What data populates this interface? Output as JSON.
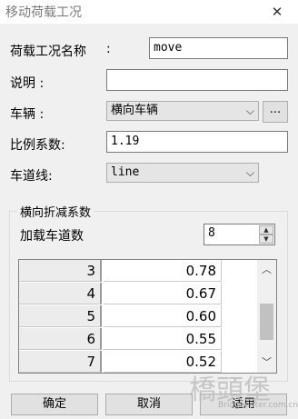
{
  "window": {
    "title": "移动荷载工况",
    "close_glyph": "✕"
  },
  "form": {
    "name_label": "荷载工况名称",
    "name_colon": ":",
    "name_value": "move",
    "desc_label": "说明 :",
    "desc_value": "",
    "vehicle_label": "车辆 :",
    "vehicle_value": "横向车辆",
    "vehicle_more": "...",
    "scale_label": "比例系数:",
    "scale_value": "1.19",
    "lane_label": "车道线:",
    "lane_value": "line"
  },
  "group": {
    "legend": "横向折减系数",
    "lanes_label": "加载车道数",
    "lanes_value": "8"
  },
  "table": {
    "rows": [
      {
        "index": "3",
        "value": "0.78"
      },
      {
        "index": "4",
        "value": "0.67"
      },
      {
        "index": "5",
        "value": "0.60"
      },
      {
        "index": "6",
        "value": "0.55"
      },
      {
        "index": "7",
        "value": "0.52"
      }
    ]
  },
  "buttons": {
    "ok": "确定",
    "cancel": "取消",
    "apply": "适用"
  },
  "watermark": {
    "logo": "橋頭堡",
    "url": "Bridgeenter.com.cn"
  }
}
